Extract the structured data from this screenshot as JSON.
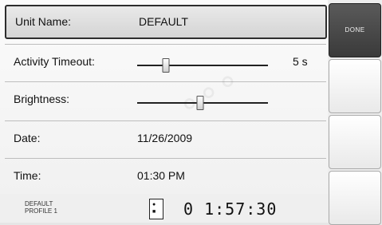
{
  "settings": {
    "unit_name": {
      "label": "Unit Name:",
      "value": "DEFAULT"
    },
    "activity_timeout": {
      "label": "Activity Timeout:",
      "value": "5 s",
      "level": 0.22
    },
    "brightness": {
      "label": "Brightness:",
      "level": 0.48
    },
    "date": {
      "label": "Date:",
      "value": "11/26/2009"
    },
    "time": {
      "label": "Time:",
      "value": "01:30 PM"
    }
  },
  "sidebar": {
    "done_label": "DONE"
  },
  "status": {
    "profile_line1": "DEFAULT",
    "profile_line2": "PROFILE 1",
    "clock": "0 1:57:30"
  }
}
